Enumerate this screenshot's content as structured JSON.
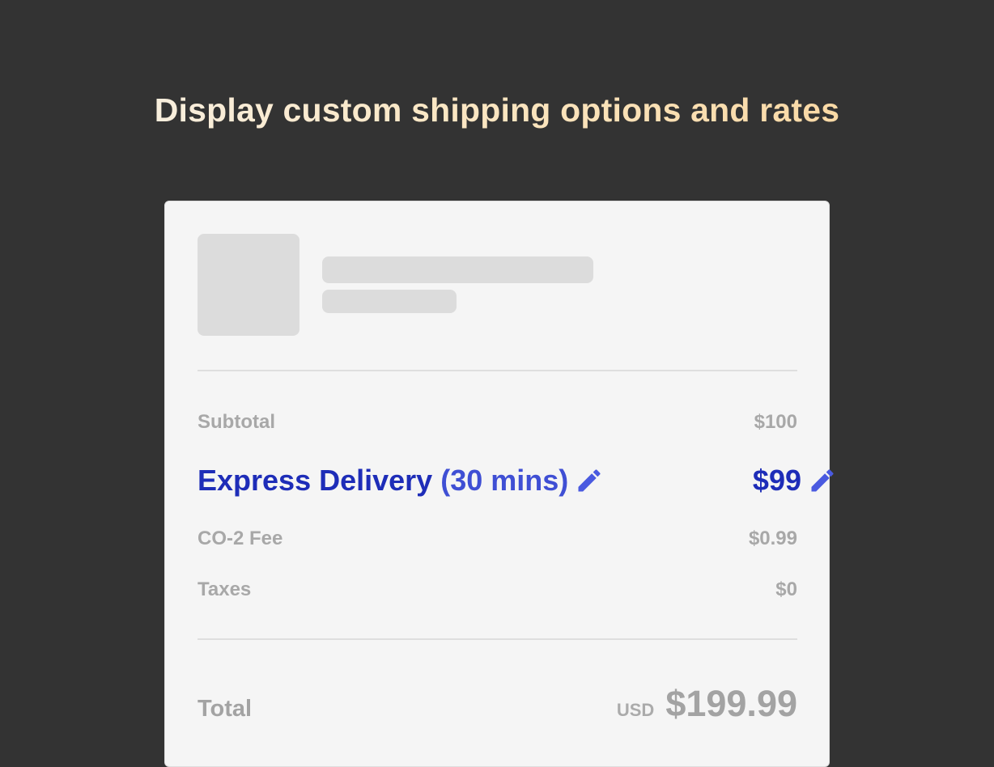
{
  "headline": "Display custom shipping options and rates",
  "summary": {
    "subtotal": {
      "label": "Subtotal",
      "value": "$100"
    },
    "shipping": {
      "label": "Express Delivery",
      "detail": "(30 mins)",
      "value": "$99"
    },
    "co2_fee": {
      "label": "CO-2 Fee",
      "value": "$0.99"
    },
    "taxes": {
      "label": "Taxes",
      "value": "$0"
    },
    "total": {
      "label": "Total",
      "currency": "USD",
      "value": "$199.99"
    }
  },
  "icons": {
    "edit_shipping_name": "pencil-icon",
    "edit_shipping_rate": "pencil-icon"
  },
  "colors": {
    "background": "#333333",
    "card": "#f5f5f5",
    "accent": "#1e2db8",
    "accent_light": "#4a5ae0",
    "muted_text": "#a8a8a8",
    "skeleton": "#dcdcdc"
  }
}
